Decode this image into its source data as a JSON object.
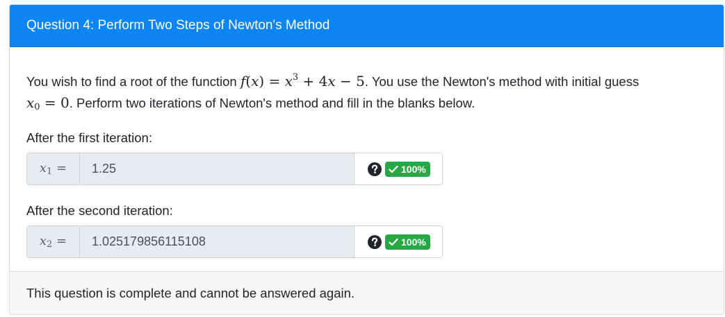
{
  "header": {
    "title": "Question 4: Perform Two Steps of Newton's Method"
  },
  "prompt": {
    "text_1": "You wish to find a root of the function ",
    "text_2": ". You use the Newton's method with initial guess",
    "text_3": ". Perform two iterations of Newton's method and fill in the blanks below."
  },
  "answers": [
    {
      "label": "After the first iteration:",
      "value": "1.25",
      "score": "100%"
    },
    {
      "label": "After the second iteration:",
      "value": "1.025179856115108",
      "score": "100%"
    }
  ],
  "footer": {
    "message": "This question is complete and cannot be answered again."
  },
  "colors": {
    "header_bg": "#0d85f5",
    "badge_success": "#28a745"
  },
  "icons": {
    "help": "question-circle-icon",
    "check": "check-icon"
  }
}
